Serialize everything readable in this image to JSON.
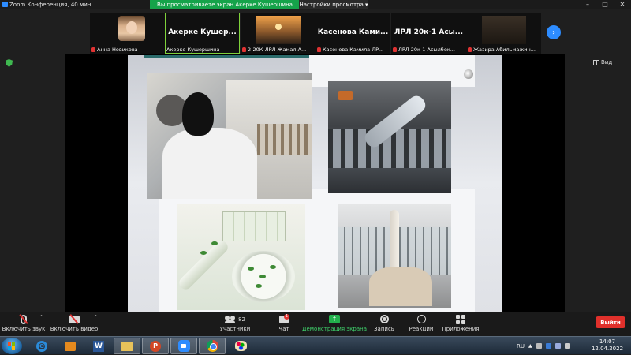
{
  "window": {
    "title": "Zoom Конференция, 40 мин",
    "share_banner": "Вы просматриваете экран Акерке Кушершина",
    "view_options": "Настройки просмотра"
  },
  "participants": [
    {
      "name": "Анна Новикова",
      "big": ""
    },
    {
      "name": "Акерке Кушершина",
      "big": "Акерке Кушер..."
    },
    {
      "name": "2-20К-ЛРЛ Жамал А...",
      "big": ""
    },
    {
      "name": "Касенова Камила ЛР...",
      "big": "Касенова Ками..."
    },
    {
      "name": "ЛРЛ 20к-1 Асылбек...",
      "big": "ЛРЛ 20к-1 Асы..."
    },
    {
      "name": "Жазира Абильмажин...",
      "big": ""
    }
  ],
  "view_button": "Вид",
  "controls": {
    "mute": "Включить звук",
    "video": "Включить видео",
    "participants": "Участники",
    "participants_count": "82",
    "chat": "Чат",
    "chat_badge": "1",
    "share": "Демонстрация экрана",
    "record": "Запись",
    "reactions": "Реакции",
    "apps": "Приложения",
    "leave": "Выйти"
  },
  "taskbar": {
    "language": "RU",
    "time": "14:07",
    "date": "12.04.2022"
  },
  "colors": {
    "share_green": "#15a34a",
    "zoom_blue": "#2d8cff",
    "leave_red": "#e0302b"
  }
}
